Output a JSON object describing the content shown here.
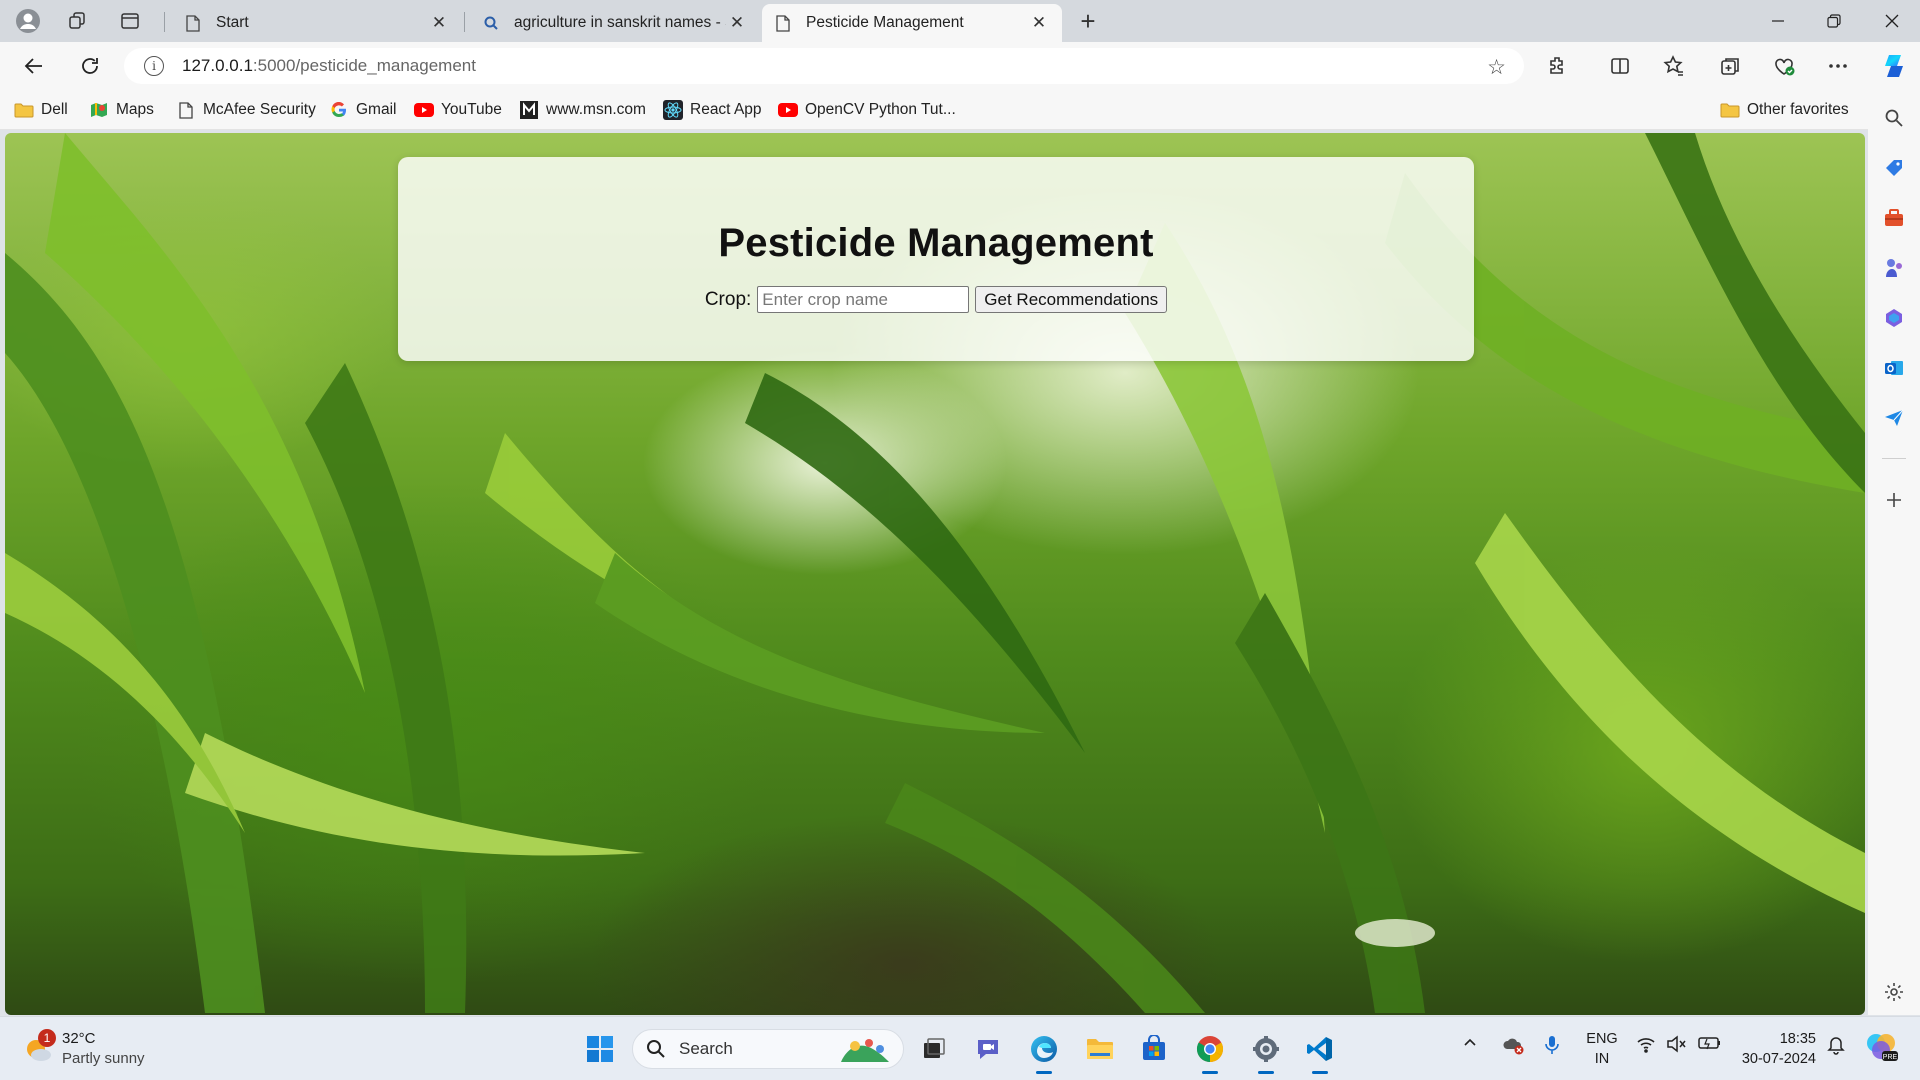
{
  "browser": {
    "tabs": [
      {
        "title": "Start",
        "icon": "page-icon",
        "active": false
      },
      {
        "title": "agriculture in sanskrit names - Se",
        "icon": "search-icon",
        "active": false
      },
      {
        "title": "Pesticide Management",
        "icon": "page-icon",
        "active": true
      }
    ],
    "address": {
      "host": "127.0.0.1",
      "path": ":5000/pesticide_management"
    },
    "favorites": [
      {
        "label": "Dell",
        "icon": "folder-icon"
      },
      {
        "label": "Maps",
        "icon": "maps-icon"
      },
      {
        "label": "McAfee Security",
        "icon": "page-icon"
      },
      {
        "label": "Gmail",
        "icon": "google-icon"
      },
      {
        "label": "YouTube",
        "icon": "youtube-icon"
      },
      {
        "label": "www.msn.com",
        "icon": "msn-icon"
      },
      {
        "label": "React App",
        "icon": "react-icon"
      },
      {
        "label": "OpenCV Python Tut...",
        "icon": "youtube-icon"
      }
    ],
    "other_favorites": "Other favorites",
    "accent": "#0067c0"
  },
  "page": {
    "title": "Pesticide Management",
    "crop_label": "Crop:",
    "crop_placeholder": "Enter crop name",
    "crop_value": "",
    "submit_label": "Get Recommendations"
  },
  "taskbar": {
    "weather": {
      "temp": "32°C",
      "condition": "Partly sunny",
      "badge": "1"
    },
    "search_label": "Search",
    "lang_line1": "ENG",
    "lang_line2": "IN",
    "time": "18:35",
    "date": "30-07-2024"
  }
}
